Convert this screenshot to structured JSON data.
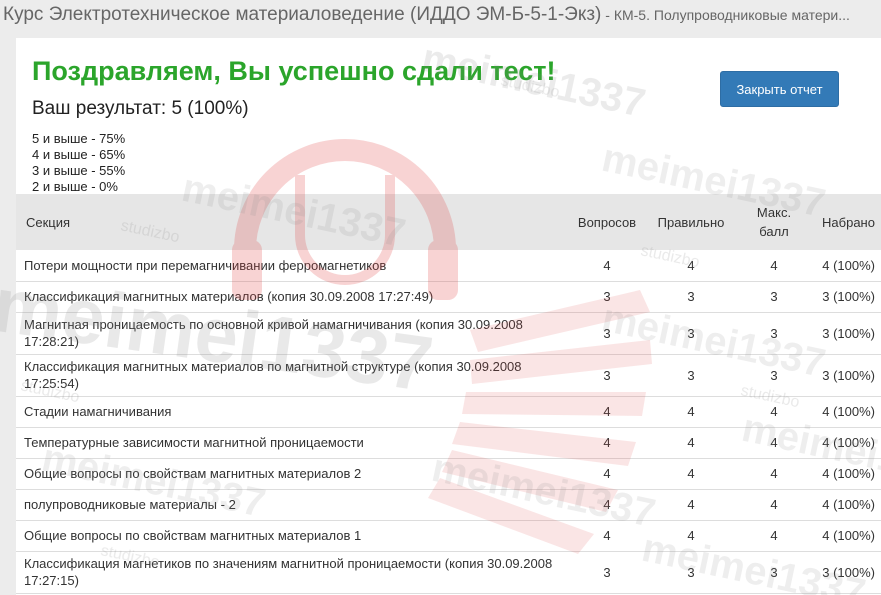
{
  "header": {
    "course_title": "Курс Электротехническое материаловедение (ИДДО ЭМ-Б-5-1-Экз)",
    "test_title": " - КМ-5. Полупроводниковые матери..."
  },
  "result": {
    "congrats": "Поздравляем, Вы успешно сдали тест!",
    "score": "Ваш результат: 5 (100%)",
    "close_label": "Закрыть отчет"
  },
  "grades": [
    "5 и выше - 75%",
    "4 и выше - 65%",
    "3 и выше - 55%",
    "2 и выше - 0%"
  ],
  "table": {
    "headers": {
      "section": "Секция",
      "questions": "Вопросов",
      "correct": "Правильно",
      "max_1": "Макс.",
      "max_2": "балл",
      "score": "Набрано"
    },
    "rows": [
      {
        "section": "Потери мощности при перемагничивании ферромагнетиков",
        "questions": "4",
        "correct": "4",
        "max": "4",
        "score": "4 (100%)"
      },
      {
        "section": "Классификация магнитных материалов (копия 30.09.2008 17:27:49)",
        "questions": "3",
        "correct": "3",
        "max": "3",
        "score": "3 (100%)"
      },
      {
        "section": "Магнитная проницаемость по основной кривой намагничивания (копия 30.09.2008 17:28:21)",
        "questions": "3",
        "correct": "3",
        "max": "3",
        "score": "3 (100%)"
      },
      {
        "section": "Классификация магнитных материалов по магнитной структуре (копия 30.09.2008 17:25:54)",
        "questions": "3",
        "correct": "3",
        "max": "3",
        "score": "3 (100%)"
      },
      {
        "section": "Стадии намагничивания",
        "questions": "4",
        "correct": "4",
        "max": "4",
        "score": "4 (100%)"
      },
      {
        "section": "Температурные зависимости магнитной проницаемости",
        "questions": "4",
        "correct": "4",
        "max": "4",
        "score": "4 (100%)"
      },
      {
        "section": "Общие вопросы по свойствам магнитных материалов 2",
        "questions": "4",
        "correct": "4",
        "max": "4",
        "score": "4 (100%)"
      },
      {
        "section": "полупроводниковые материалы - 2",
        "questions": "4",
        "correct": "4",
        "max": "4",
        "score": "4 (100%)"
      },
      {
        "section": "Общие вопросы по свойствам магнитных материалов 1",
        "questions": "4",
        "correct": "4",
        "max": "4",
        "score": "4 (100%)"
      },
      {
        "section": "Классификация магнетиков по значениям магнитной проницаемости (копия 30.09.2008 17:27:15)",
        "questions": "3",
        "correct": "3",
        "max": "3",
        "score": "3 (100%)"
      }
    ]
  },
  "watermark": {
    "text": "meimei1337",
    "logo_text": "studizbo",
    "logo_color": "#e03c3c",
    "text_color": "#8a8a8a"
  },
  "colors": {
    "success": "#2ba52b",
    "button": "#337ab7",
    "header_bg": "#e6e6e6"
  }
}
